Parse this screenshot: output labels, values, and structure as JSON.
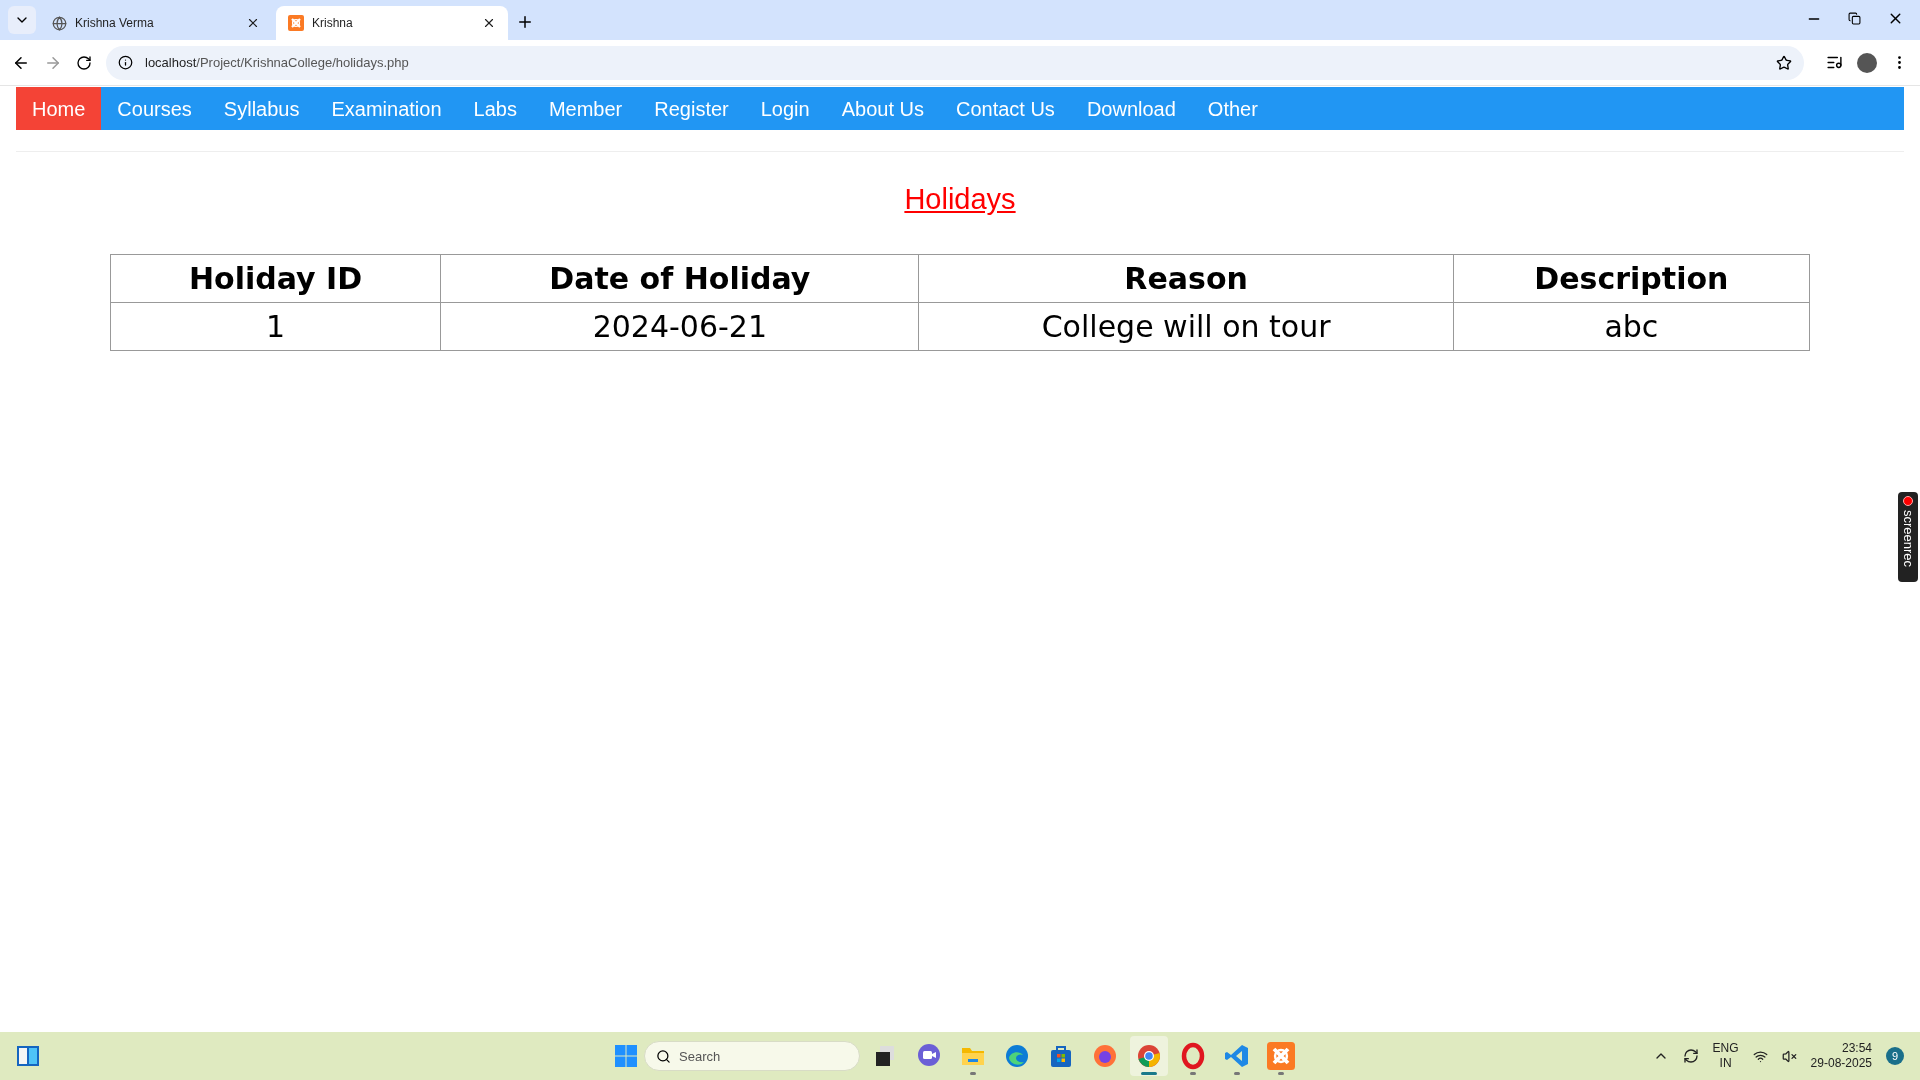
{
  "browser": {
    "tabs": [
      {
        "title": "Krishna Verma",
        "kind": "globe",
        "selected": false
      },
      {
        "title": "Krishna",
        "kind": "xampp",
        "selected": true
      }
    ],
    "address": {
      "host": "localhost",
      "path": "/Project/KrishnaCollege/holidays.php"
    }
  },
  "nav": [
    {
      "label": "Home",
      "selected": true
    },
    {
      "label": "Courses",
      "selected": false
    },
    {
      "label": "Syllabus",
      "selected": false
    },
    {
      "label": "Examination",
      "selected": false
    },
    {
      "label": "Labs",
      "selected": false
    },
    {
      "label": "Member",
      "selected": false
    },
    {
      "label": "Register",
      "selected": false
    },
    {
      "label": "Login",
      "selected": false
    },
    {
      "label": "About Us",
      "selected": false
    },
    {
      "label": "Contact Us",
      "selected": false
    },
    {
      "label": "Download",
      "selected": false
    },
    {
      "label": "Other",
      "selected": false
    }
  ],
  "page_title": "Holidays",
  "table": {
    "columns": [
      "Holiday ID",
      "Date of Holiday",
      "Reason",
      "Description"
    ],
    "rows": [
      [
        "1",
        "2024-06-21",
        "College will on tour",
        "abc"
      ]
    ]
  },
  "recorder_tab": "screenrec",
  "taskbar": {
    "search": {
      "placeholder": "Search"
    },
    "apps": [
      {
        "kind": "taskview",
        "running": false,
        "selected": false
      },
      {
        "kind": "meet",
        "running": false,
        "selected": false
      },
      {
        "kind": "folder",
        "running": true,
        "selected": false
      },
      {
        "kind": "edge",
        "running": false,
        "selected": false
      },
      {
        "kind": "store",
        "running": false,
        "selected": false
      },
      {
        "kind": "firefox",
        "running": false,
        "selected": false
      },
      {
        "kind": "chrome",
        "running": true,
        "selected": true
      },
      {
        "kind": "opera",
        "running": true,
        "selected": false
      },
      {
        "kind": "vscode",
        "running": true,
        "selected": false
      },
      {
        "kind": "xampp",
        "running": true,
        "selected": false
      }
    ],
    "language": "ENG",
    "region": "IN",
    "time": "23:54",
    "date": "29-08-2025",
    "notifications": "9"
  }
}
